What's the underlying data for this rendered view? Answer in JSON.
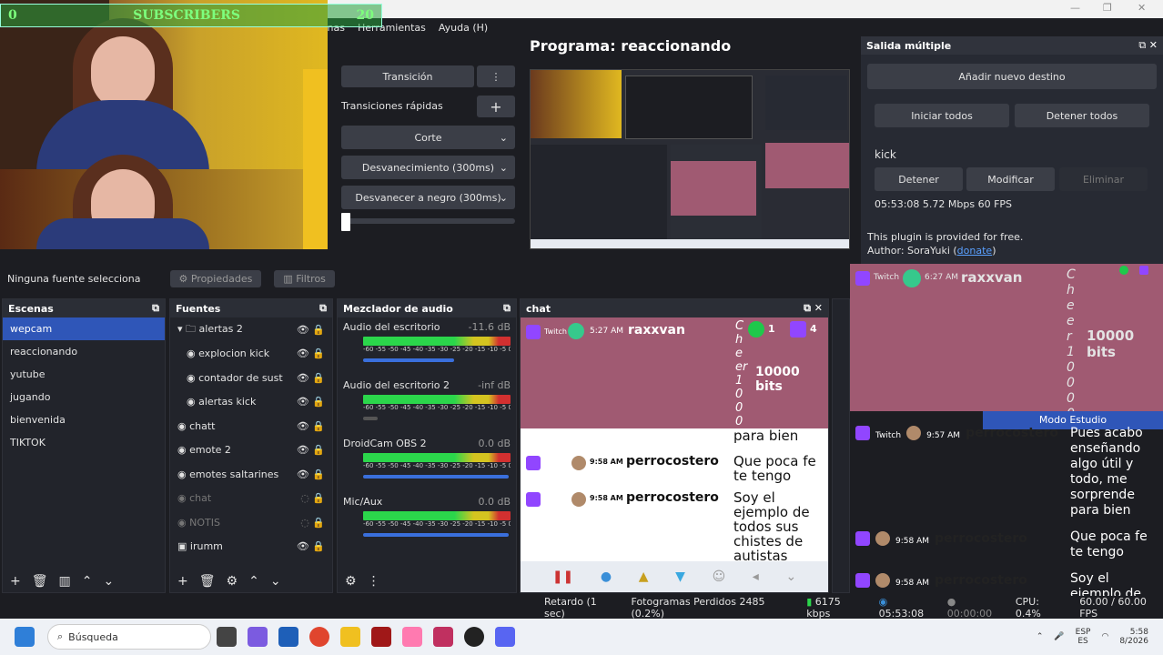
{
  "menu": [
    "Escenas",
    "Herramientas",
    "Ayuda (H)"
  ],
  "overlay": {
    "subs_left": "0",
    "subs_label": "SUBSCRIBERS",
    "subs_right": "20"
  },
  "transitions": {
    "transition_label": "Transición",
    "quick_label": "Transiciones rápidas",
    "items": [
      "Corte",
      "Desvanecimiento (300ms)",
      "Desvanecer a negro (300ms)"
    ]
  },
  "program": {
    "title": "Programa: reaccionando"
  },
  "multi_output": {
    "title": "Salida múltiple",
    "add": "Añadir nuevo destino",
    "start_all": "Iniciar todos",
    "stop_all": "Detener todos",
    "target_name": "kick",
    "stop": "Detener",
    "modify": "Modificar",
    "delete": "Eliminar",
    "stats": "05:53:08  5.72 Mbps  60 FPS",
    "free": "This plugin is provided for free.",
    "author": "Author: SoraYuki (",
    "donate": "donate",
    "author_end": ")"
  },
  "sel_bar": {
    "none": "Ninguna fuente selecciona",
    "props": "Propiedades",
    "filters": "Filtros"
  },
  "scenes": {
    "title": "Escenas",
    "items": [
      "wepcam",
      "reaccionando",
      "yutube",
      "jugando",
      "bienvenida",
      "TIKTOK"
    ]
  },
  "sources": {
    "title": "Fuentes",
    "items": [
      "alertas 2",
      "explocion kick",
      "contador de sust",
      "alertas kick",
      "chatt",
      "emote 2",
      "emotes saltarines",
      "chat",
      "NOTIS",
      "irumm"
    ]
  },
  "mixer": {
    "title": "Mezclador de audio",
    "tracks": [
      {
        "name": "Audio del escritorio",
        "db": "-11.6 dB"
      },
      {
        "name": "Audio del escritorio 2",
        "db": "-inf dB"
      },
      {
        "name": "DroidCam OBS 2",
        "db": "0.0 dB"
      },
      {
        "name": "Mic/Aux",
        "db": "0.0 dB"
      }
    ],
    "scale": "-60 -55 -50 -45 -40 -35 -30 -25 -20 -15 -10 -5 0"
  },
  "chat_dock": {
    "title": "chat",
    "cheer_user": "raxxvan",
    "cheer_text": "10000 bits",
    "cheer_vertical": "Cheer10000",
    "badges": [
      "1",
      "4"
    ],
    "time1": "5:27 AM",
    "msg_tail": "para bien",
    "time2": "9:58 AM",
    "msg2": "Que poca fe te tengo",
    "time3": "9:58 AM",
    "msg3": "Soy el ejemplo de todos sus chistes de autistas",
    "user2": "perrocostero"
  },
  "right_chat": {
    "user": "raxxvan",
    "bits": "10000 bits",
    "cheer_vertical": "Cheer10000",
    "time": "6:27 AM",
    "studio": "Modo Estudio",
    "m1_time": "9:57 AM",
    "m1": "Pues acabo enseñando algo útil y todo, me sorprende para bien",
    "m2_time": "9:58 AM",
    "m2": "Que poca fe te tengo",
    "m3_time": "9:58 AM",
    "m3": "Soy el ejemplo de todos sus chistes de autistas",
    "user2": "perrocostero",
    "platform": "Twitch"
  },
  "footer": {
    "delay": "Retardo (1 sec)",
    "frames": "Fotogramas Perdidos 2485 (0.2%)",
    "kbps": "6175 kbps",
    "stream_time": "05:53:08",
    "rec_time": "00:00:00",
    "cpu": "CPU: 0.4%",
    "fps": "60.00 / 60.00 FPS"
  },
  "taskbar": {
    "search": "Búsqueda",
    "lang1": "ESP",
    "lang2": "ES",
    "time": "5:58",
    "date": "8/2026"
  }
}
